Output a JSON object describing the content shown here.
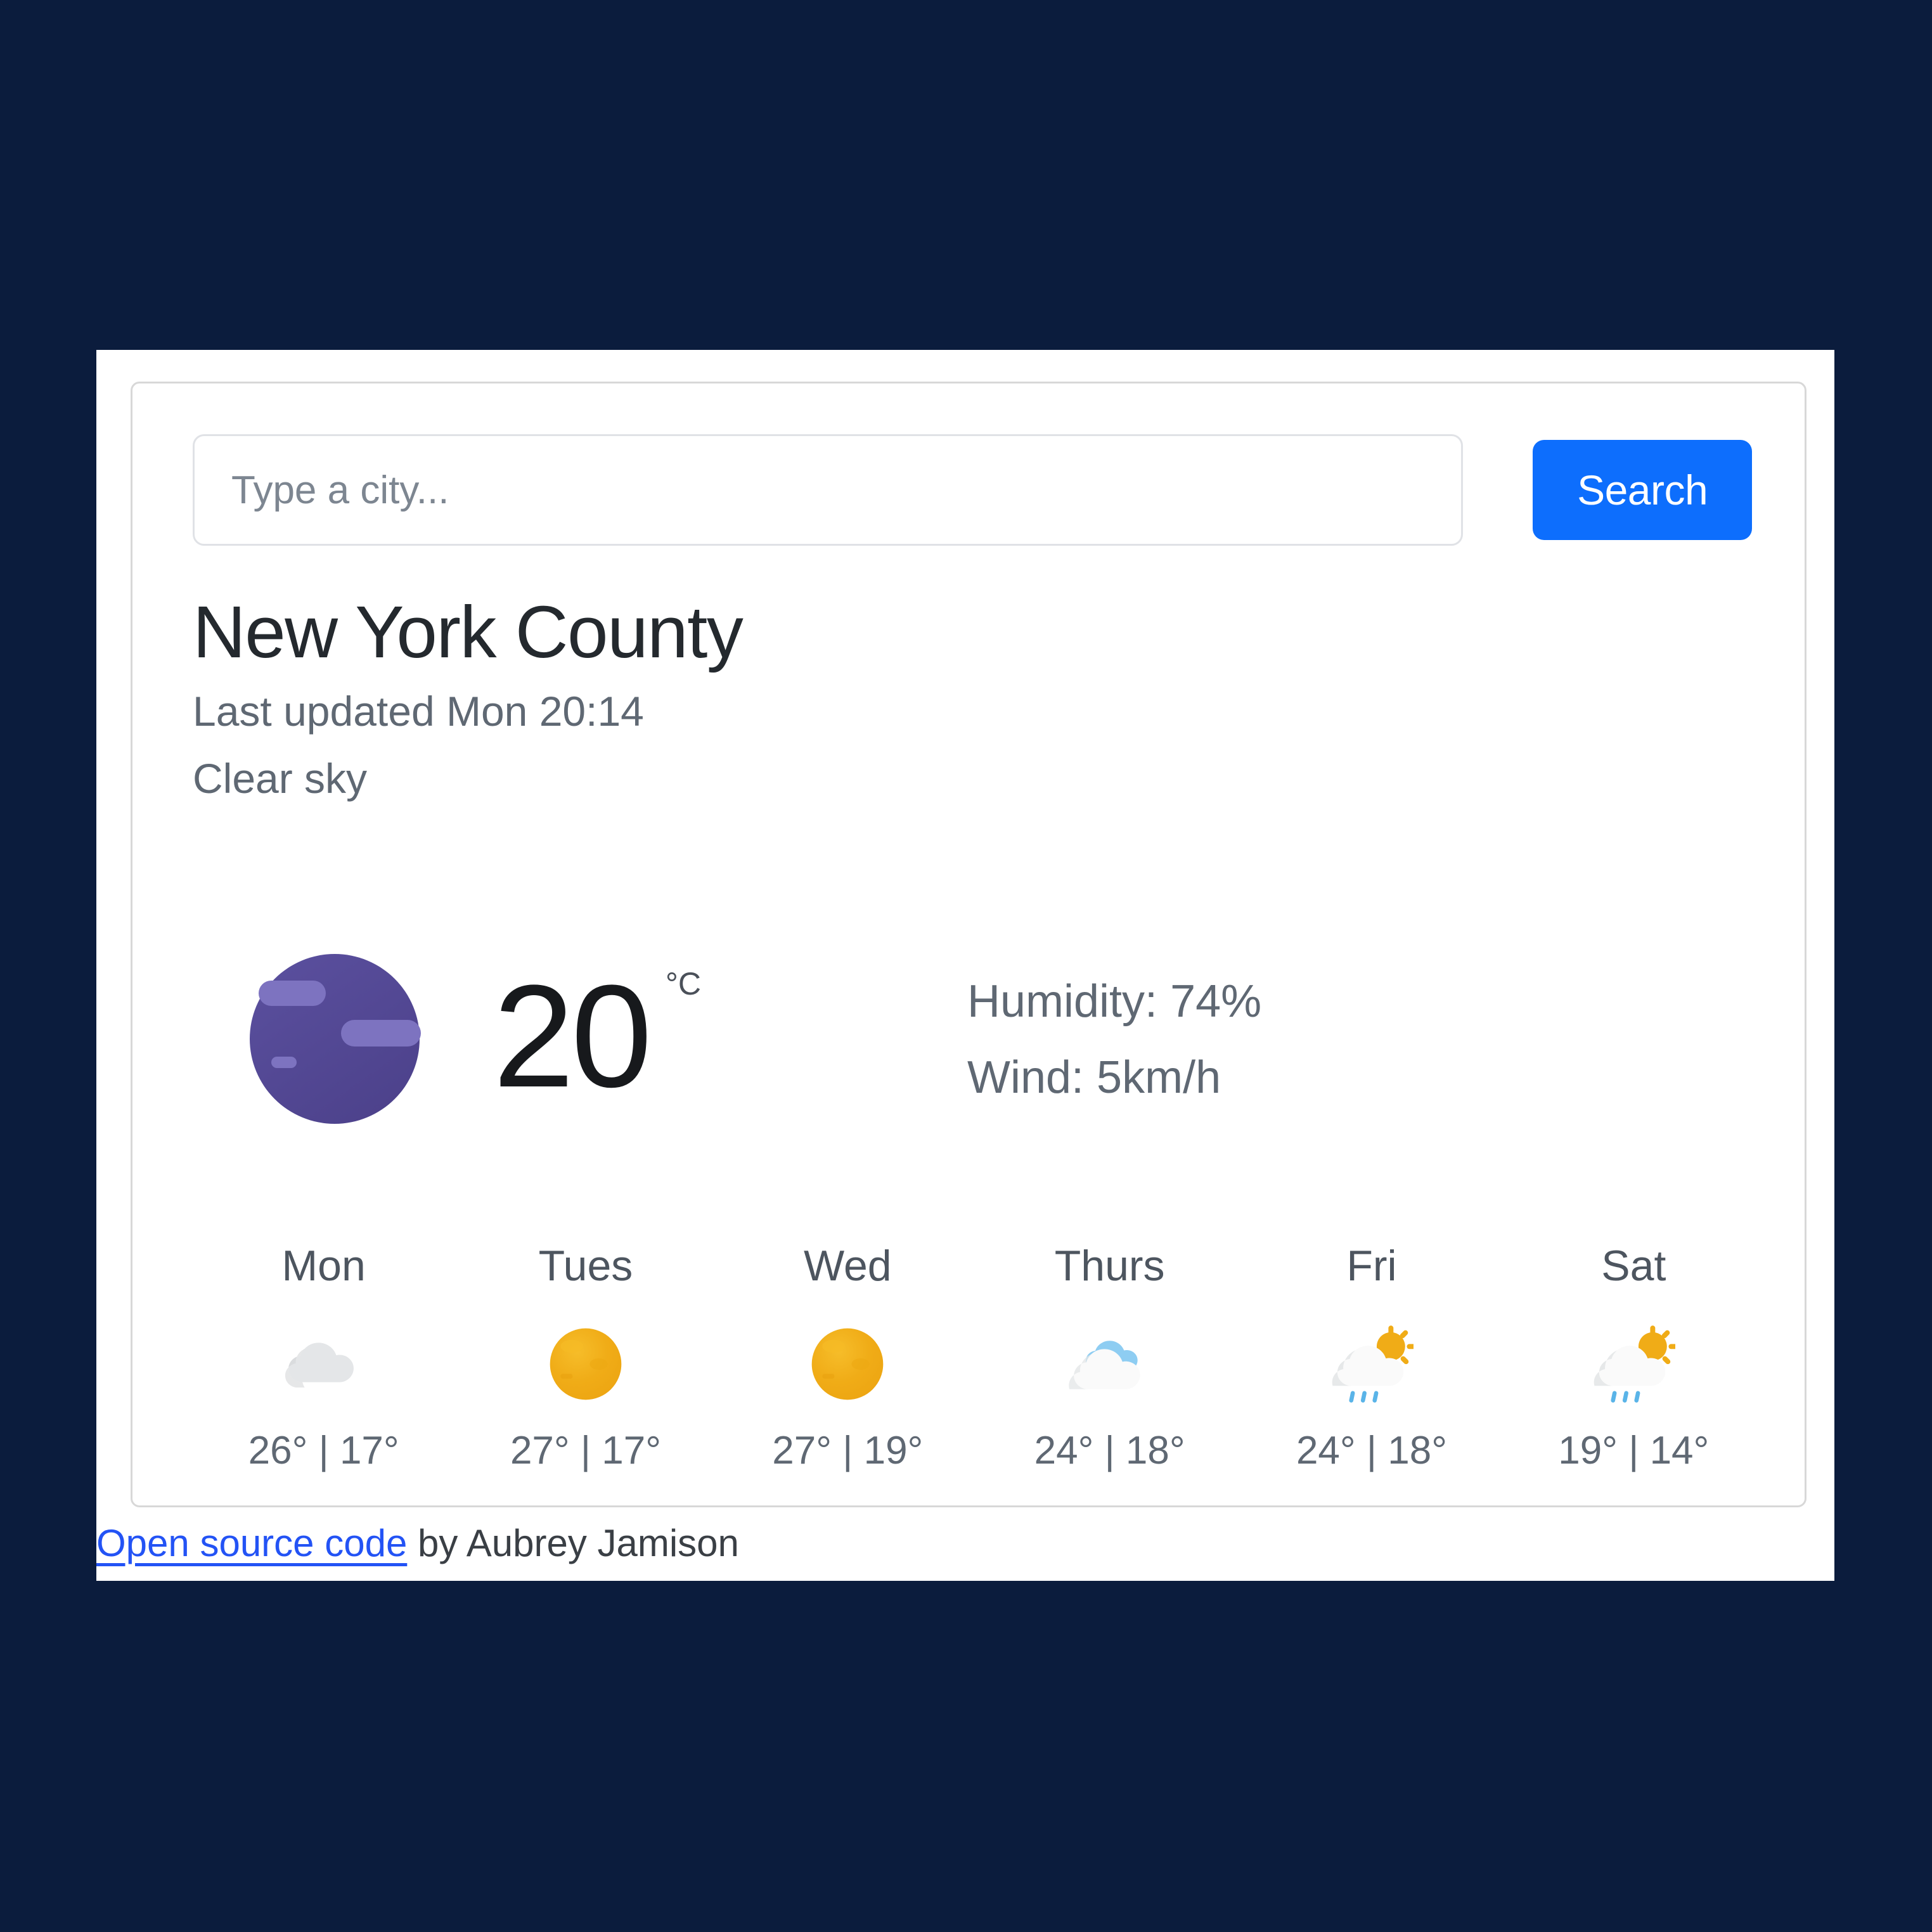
{
  "search": {
    "placeholder": "Type a city...",
    "value": "",
    "button_label": "Search"
  },
  "location": {
    "city": "New York County",
    "last_updated": "Last updated Mon 20:14",
    "condition": "Clear sky"
  },
  "current": {
    "icon": "new-moon-icon",
    "temperature": "20",
    "unit": "°C",
    "humidity": "Humidity: 74%",
    "wind": "Wind: 5km/h"
  },
  "forecast": [
    {
      "day": "Mon",
      "icon": "cloud-icon",
      "temps": "26° | 17°"
    },
    {
      "day": "Tues",
      "icon": "sun-icon",
      "temps": "27° | 17°"
    },
    {
      "day": "Wed",
      "icon": "sun-icon",
      "temps": "27° | 19°"
    },
    {
      "day": "Thurs",
      "icon": "sun-behind-cloud-icon",
      "temps": "24° | 18°"
    },
    {
      "day": "Fri",
      "icon": "sun-behind-rain-cloud-icon",
      "temps": "24° | 18°"
    },
    {
      "day": "Sat",
      "icon": "sun-behind-rain-cloud-icon",
      "temps": "19° | 14°"
    }
  ],
  "footer": {
    "link_text": "Open source code",
    "byline": " by Aubrey Jamison"
  },
  "colors": {
    "page_background": "#0b1c3d",
    "card_background": "#ffffff",
    "accent_blue": "#0d6efd",
    "link_blue": "#2353f5",
    "moon_purple": "#54499c",
    "sun_amber": "#f0ac17",
    "cloud_grey": "#e3e5e7",
    "cloud_blue": "#78c4f0",
    "rain_blue": "#5ab4e8",
    "text_primary": "#24292e",
    "text_muted": "#5f6873"
  }
}
